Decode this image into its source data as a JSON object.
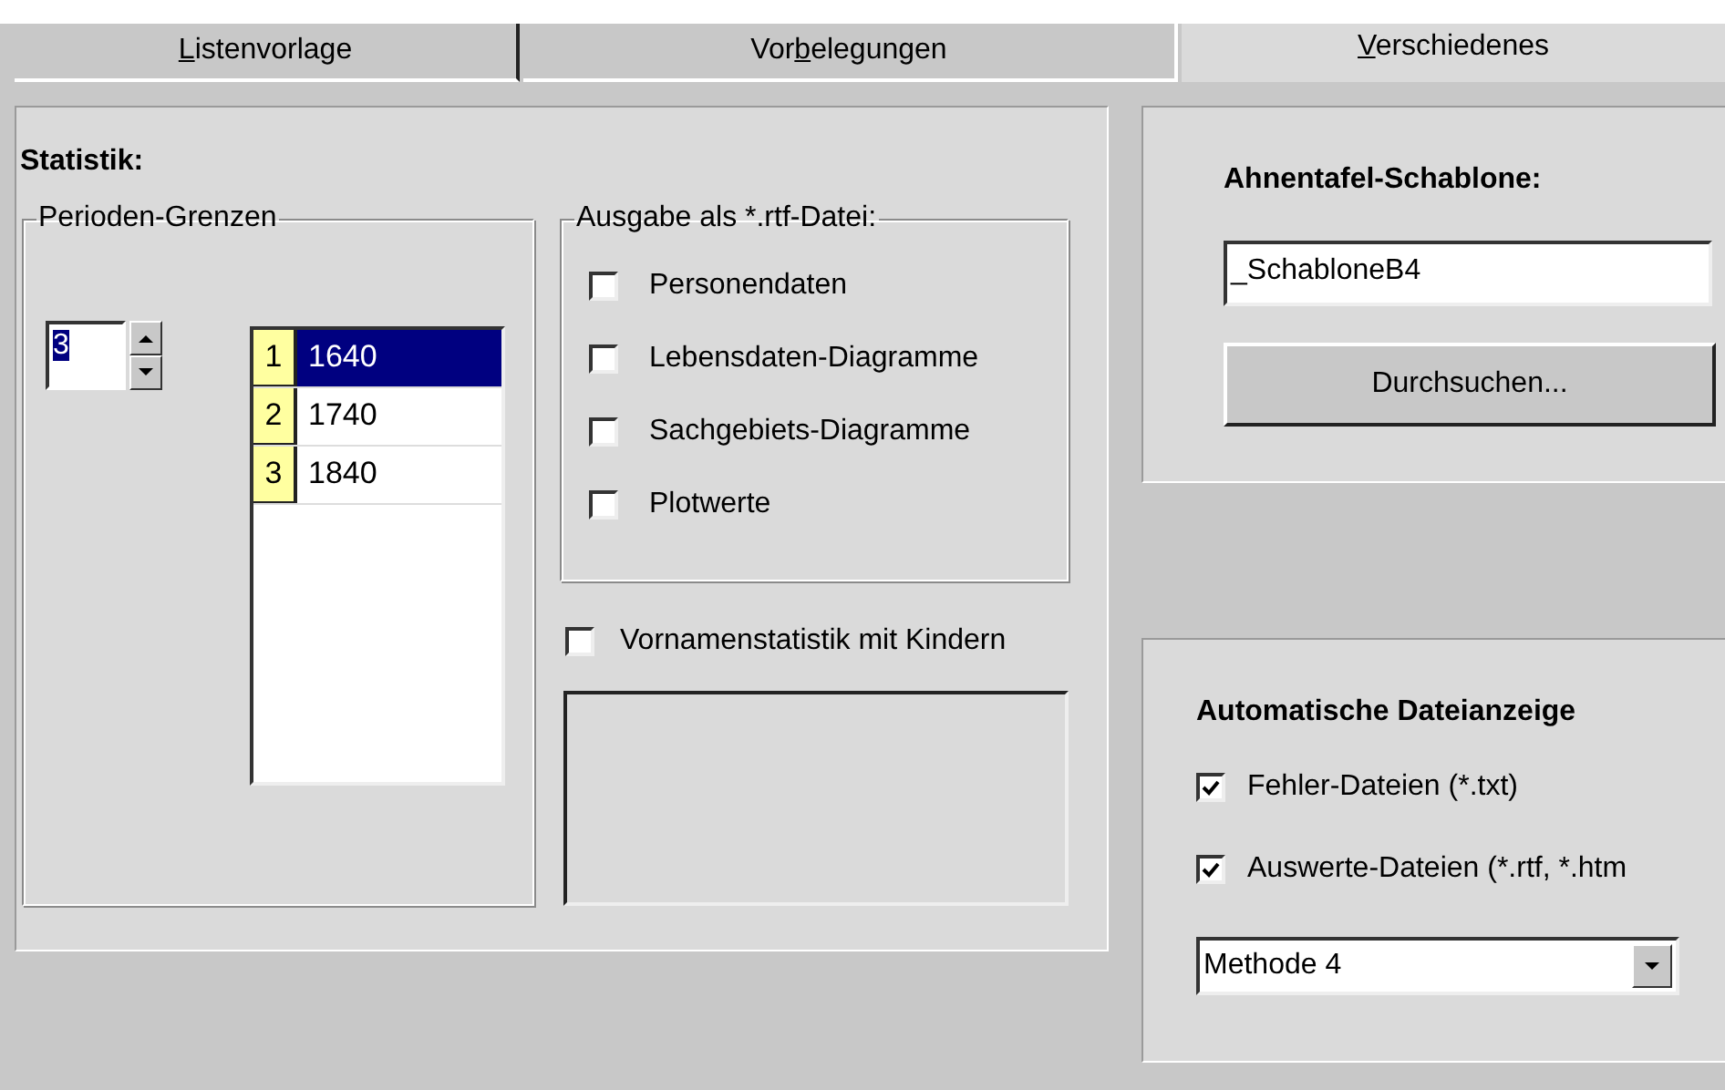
{
  "tabs": [
    {
      "label_parts": [
        {
          "text": "L",
          "underlined": true
        },
        {
          "text": "istenvorlage",
          "underlined": false
        }
      ],
      "selected": false
    },
    {
      "label_parts": [
        {
          "text": "Vor",
          "underlined": false
        },
        {
          "text": "b",
          "underlined": true
        },
        {
          "text": "elegungen",
          "underlined": false
        }
      ],
      "selected": false
    },
    {
      "label_parts": [
        {
          "text": "V",
          "underlined": true
        },
        {
          "text": "erschiedenes",
          "underlined": false
        }
      ],
      "selected": true
    }
  ],
  "statistik": {
    "title": "Statistik:",
    "perioden": {
      "label": "Perioden-Grenzen",
      "spinner": {
        "value": "3",
        "text_selected": true
      },
      "rows": [
        {
          "index": "1",
          "value": "1640",
          "selected": true
        },
        {
          "index": "2",
          "value": "1740",
          "selected": false
        },
        {
          "index": "3",
          "value": "1840",
          "selected": false
        }
      ]
    },
    "ausgabe": {
      "label": "Ausgabe als *.rtf-Datei:",
      "options": [
        {
          "label": "Personendaten",
          "checked": false
        },
        {
          "label": "Lebensdaten-Diagramme",
          "checked": false
        },
        {
          "label": "Sachgebiets-Diagramme",
          "checked": false
        },
        {
          "label": "Plotwerte",
          "checked": false
        }
      ]
    },
    "vornamen": {
      "label": "Vornamenstatistik mit Kindern",
      "checked": false
    }
  },
  "schablone": {
    "title": "Ahnentafel-Schablone:",
    "value": "_SchabloneB4",
    "button": "Durchsuchen..."
  },
  "dateianzeige": {
    "title": "Automatische Dateianzeige",
    "options": [
      {
        "label": "Fehler-Dateien (*.txt)",
        "checked": true
      },
      {
        "label": "Auswerte-Dateien (*.rtf, *.htm",
        "checked": true
      }
    ],
    "method": "Methode 4"
  }
}
